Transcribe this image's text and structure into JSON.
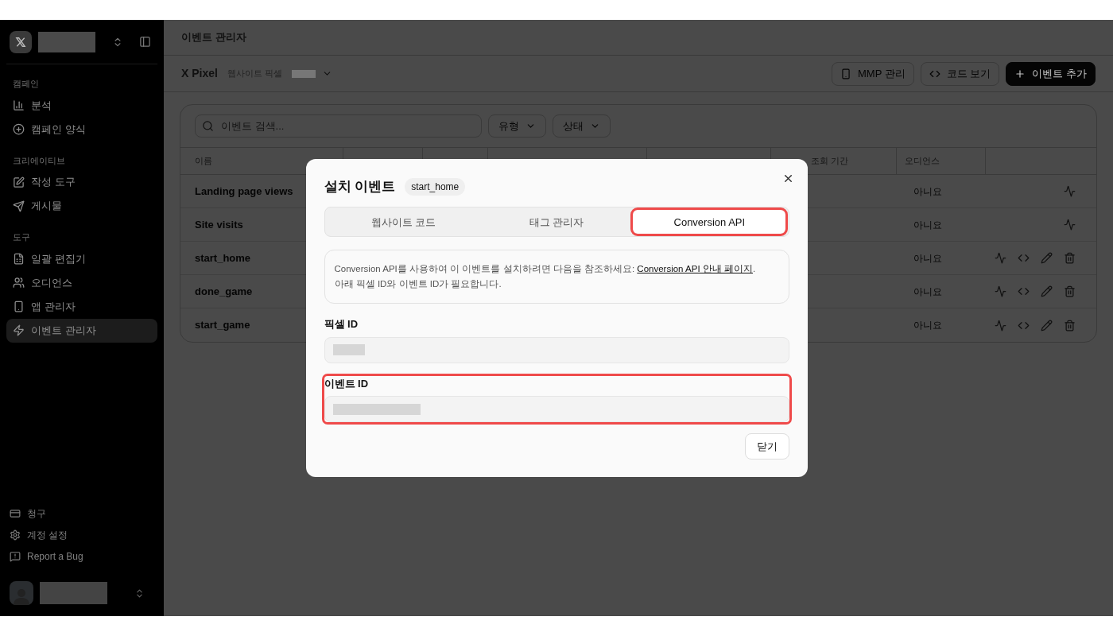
{
  "sidebar": {
    "sections": [
      {
        "title": "캠페인",
        "items": [
          {
            "label": "분석",
            "selected": false
          },
          {
            "label": "캠페인 양식",
            "selected": false
          }
        ]
      },
      {
        "title": "크리에이티브",
        "items": [
          {
            "label": "작성 도구",
            "selected": false
          },
          {
            "label": "게시물",
            "selected": false
          }
        ]
      },
      {
        "title": "도구",
        "items": [
          {
            "label": "일괄 편집기",
            "selected": false
          },
          {
            "label": "오디언스",
            "selected": false
          },
          {
            "label": "앱 관리자",
            "selected": false
          },
          {
            "label": "이벤트 관리자",
            "selected": true
          }
        ]
      }
    ],
    "footer_items": [
      {
        "label": "청구"
      },
      {
        "label": "계정 설정"
      },
      {
        "label": "Report a Bug"
      }
    ]
  },
  "page_title": "이벤트 관리자",
  "toolbar": {
    "pixel_name": "X Pixel",
    "pixel_type": "웹사이트 픽셀",
    "buttons": [
      {
        "label": "MMP 관리",
        "kind": "outline"
      },
      {
        "label": "코드 보기",
        "kind": "outline"
      },
      {
        "label": "이벤트 추가",
        "kind": "primary"
      }
    ]
  },
  "filters": {
    "search_placeholder": "이벤트 검색...",
    "dropdowns": [
      "유형",
      "상태"
    ]
  },
  "table": {
    "columns": {
      "name": "이름",
      "column_6": "조회 기간",
      "audience": "오디언스"
    },
    "rows": [
      {
        "name": "Landing page views",
        "audience": "아니요",
        "editable": false
      },
      {
        "name": "Site visits",
        "audience": "아니요",
        "editable": false
      },
      {
        "name": "start_home",
        "audience": "아니요",
        "editable": true
      },
      {
        "name": "done_game",
        "audience": "아니요",
        "editable": true
      },
      {
        "name": "start_game",
        "audience": "아니요",
        "editable": true
      }
    ]
  },
  "dialog": {
    "title": "설치 이벤트",
    "badge": "start_home",
    "tabs": [
      {
        "label": "웹사이트 코드",
        "selected": false,
        "highlighted": false
      },
      {
        "label": "태그 관리자",
        "selected": false,
        "highlighted": false
      },
      {
        "label": "Conversion API",
        "selected": true,
        "highlighted": true
      }
    ],
    "info": {
      "text": "Conversion API를 사용하여 이 이벤트를 설치하려면 다음을 참조하세요: ",
      "link": "Conversion API 안내 페이지",
      "text_after": ".",
      "line2": "아래 픽셀 ID와 이벤트 ID가 필요합니다."
    },
    "fields": [
      {
        "label": "픽셀 ID",
        "highlighted": false
      },
      {
        "label": "이벤트 ID",
        "highlighted": true
      }
    ],
    "close_button": "닫기"
  }
}
